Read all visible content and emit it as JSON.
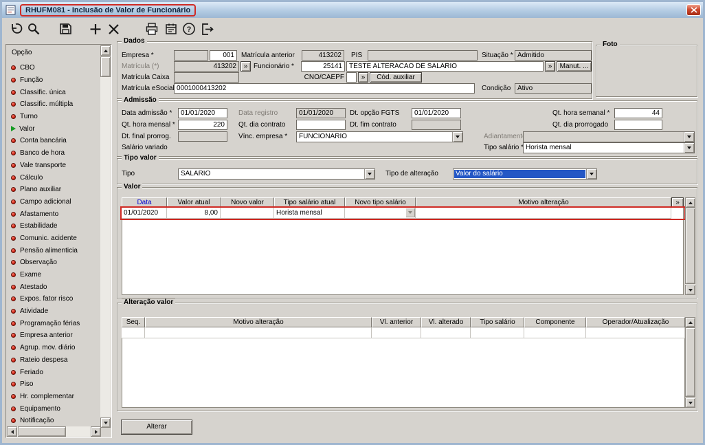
{
  "window": {
    "title": "RHUFM081 - Inclusão de Valor de Funcionário"
  },
  "toolbar": {
    "buttons": [
      "undo",
      "search",
      "save",
      "add",
      "delete",
      "print",
      "calendar",
      "help",
      "exit"
    ]
  },
  "sidebar": {
    "header": "Opção",
    "selected_index": 5,
    "items": [
      "CBO",
      "Função",
      "Classific. única",
      "Classific. múltipla",
      "Turno",
      "Valor",
      "Conta bancária",
      "Banco de hora",
      "Vale transporte",
      "Cálculo",
      "Plano auxiliar",
      "Campo adicional",
      "Afastamento",
      "Estabilidade",
      "Comunic. acidente",
      "Pensão alimenticia",
      "Observação",
      "Exame",
      "Atestado",
      "Expos. fator risco",
      "Atividade",
      "Programação férias",
      "Empresa anterior",
      "Agrup. mov. diário",
      "Rateio despesa",
      "Feriado",
      "Piso",
      "Hr. complementar",
      "Equipamento",
      "Notificação"
    ]
  },
  "ui": {
    "more": "»"
  },
  "dados": {
    "title": "Dados",
    "empresa": {
      "label": "Empresa *",
      "value": "001"
    },
    "matricula_anterior": {
      "label": "Matrícula anterior",
      "value": "413202"
    },
    "pis": {
      "label": "PIS",
      "value": ""
    },
    "situacao": {
      "label": "Situação *",
      "value": "Admitido"
    },
    "matricula": {
      "label": "Matrícula (*)",
      "value": "413202"
    },
    "funcionario": {
      "label": "Funcionário *",
      "code": "25141",
      "name": "TESTE ALTERACAO DE SALARIO"
    },
    "manut_button": "Manut. ...",
    "matricula_caixa": {
      "label": "Matrícula Caixa",
      "value": ""
    },
    "cno_caepf": {
      "label": "CNO/CAEPF",
      "value": ""
    },
    "cod_auxiliar_button": "Cód. auxiliar",
    "matricula_esocial": {
      "label": "Matrícula eSocial",
      "value": "0001000413202"
    },
    "condicao": {
      "label": "Condição",
      "value": "Ativo"
    }
  },
  "foto": {
    "title": "Foto"
  },
  "admissao": {
    "title": "Admissão",
    "data_admissao": {
      "label": "Data admissão *",
      "value": "01/01/2020"
    },
    "data_registro": {
      "label": "Data registro",
      "value": "01/01/2020"
    },
    "dt_opcao_fgts": {
      "label": "Dt. opção FGTS",
      "value": "01/01/2020"
    },
    "qt_hora_semanal": {
      "label": "Qt. hora semanal *",
      "value": "44"
    },
    "qt_hora_mensal": {
      "label": "Qt. hora mensal *",
      "value": "220"
    },
    "qt_dia_contrato": {
      "label": "Qt. dia contrato",
      "value": ""
    },
    "dt_fim_contrato": {
      "label": "Dt. fim contrato",
      "value": ""
    },
    "qt_dia_prorrogado": {
      "label": "Qt. dia prorrogado",
      "value": ""
    },
    "dt_final_prorrog": {
      "label": "Dt. final prorrog.",
      "value": ""
    },
    "vinc_empresa": {
      "label": "Vínc. empresa *",
      "value": "FUNCIONARIO"
    },
    "adiantamento": {
      "label": "Adiantamento",
      "value": ""
    },
    "salario_variado": {
      "label": "Salário variado"
    },
    "tipo_salario": {
      "label": "Tipo salário *",
      "value": "Horista mensal"
    }
  },
  "tipo_valor": {
    "title": "Tipo valor",
    "tipo": {
      "label": "Tipo",
      "value": "SALARIO"
    },
    "tipo_alteracao": {
      "label": "Tipo de alteração",
      "value": "Valor do salário"
    }
  },
  "valor": {
    "title": "Valor",
    "columns": [
      "Data",
      "Valor atual",
      "Novo valor",
      "Tipo salário atual",
      "Novo tipo salário",
      "Motivo alteração"
    ],
    "rows": [
      [
        "01/01/2020",
        "8,00",
        "",
        "Horista mensal",
        "",
        ""
      ]
    ]
  },
  "alteracao_valor": {
    "title": "Alteração valor",
    "columns": [
      "Seq.",
      "Motivo alteração",
      "Vl. anterior",
      "Vl. alterado",
      "Tipo salário",
      "Componente",
      "Operador/Atualização"
    ],
    "rows": []
  },
  "footer": {
    "alterar_button": "Alterar"
  },
  "colors": {
    "selection_blue": "#2457c5",
    "header_link_blue": "#0000cc",
    "annotation_red": "#cf2a24",
    "titlebar_blue": "#b3cbe3"
  }
}
